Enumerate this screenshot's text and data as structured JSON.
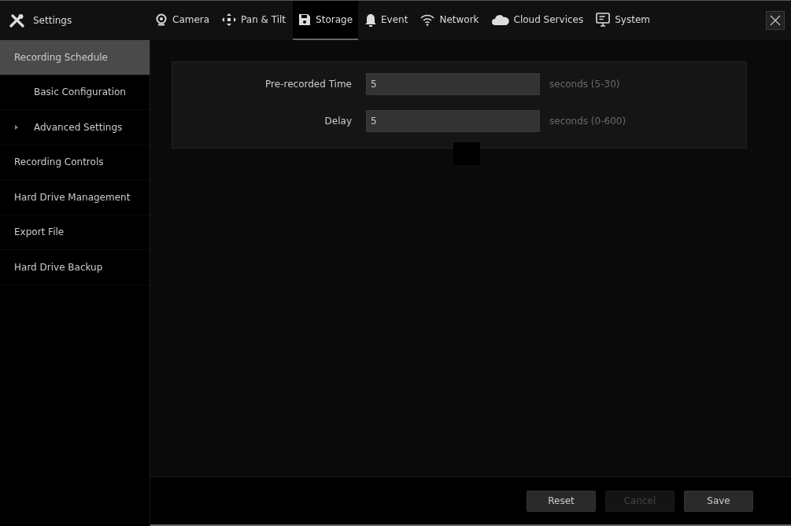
{
  "header": {
    "title": "Settings"
  },
  "tabs": [
    {
      "label": "Camera",
      "selected": false
    },
    {
      "label": "Pan & Tilt",
      "selected": false
    },
    {
      "label": "Storage",
      "selected": true
    },
    {
      "label": "Event",
      "selected": false
    },
    {
      "label": "Network",
      "selected": false
    },
    {
      "label": "Cloud Services",
      "selected": false
    },
    {
      "label": "System",
      "selected": false
    }
  ],
  "sidebar": {
    "items": [
      {
        "label": "Recording Schedule",
        "selected": true,
        "children": [
          {
            "label": "Basic Configuration",
            "selected": false
          },
          {
            "label": "Advanced Settings",
            "selected": false,
            "expanded": false
          }
        ]
      },
      {
        "label": "Recording Controls",
        "selected": false
      },
      {
        "label": "Hard Drive Management",
        "selected": false
      },
      {
        "label": "Export File",
        "selected": false
      },
      {
        "label": "Hard Drive Backup",
        "selected": false
      }
    ]
  },
  "form": {
    "fields": [
      {
        "label": "Pre-recorded Time",
        "value": "5",
        "hint": "seconds (5-30)"
      },
      {
        "label": "Delay",
        "value": "5",
        "hint": "seconds (0-600)"
      }
    ]
  },
  "buttons": [
    {
      "label": "Reset",
      "disabled": false
    },
    {
      "label": "Cancel",
      "disabled": true
    },
    {
      "label": "Save",
      "disabled": false
    }
  ]
}
